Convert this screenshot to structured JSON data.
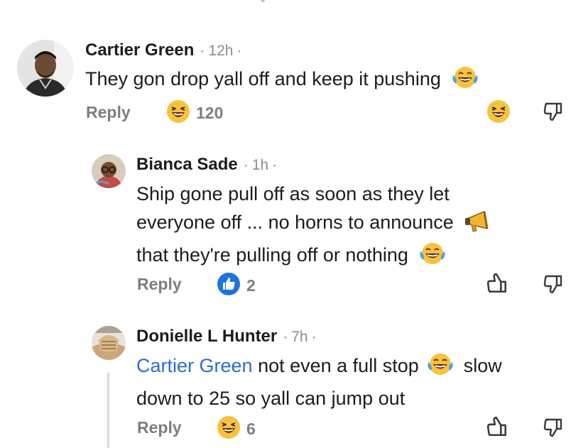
{
  "comments": [
    {
      "author": "Cartier Green",
      "time": "12h",
      "text": "They gon drop yall off and keep it pushing",
      "text_emoji": "laughing-tears-emoji",
      "reply_label": "Reply",
      "reaction_icon": "haha-reaction",
      "reaction_count": "120"
    },
    {
      "author": "Bianca Sade",
      "time": "1h",
      "text_line1": "Ship gone pull off as soon as they let",
      "text_line2": "everyone off ... no horns to announce",
      "text_line2_emoji": "megaphone-emoji",
      "text_line3": "that they're pulling off or nothing",
      "text_line3_emoji": "laughing-tears-emoji",
      "reply_label": "Reply",
      "reaction_icon": "like-reaction",
      "reaction_count": "2"
    },
    {
      "author": "Donielle L Hunter",
      "time": "7h",
      "mention": "Cartier Green",
      "text_part1": "not even a full stop",
      "text_part1_emoji": "laughing-tears-emoji",
      "text_part2": "slow",
      "text_line2": "down to 25 so yall can jump out",
      "reply_label": "Reply",
      "reaction_icon": "haha-reaction",
      "reaction_count": "6"
    }
  ],
  "separator": "·",
  "colors": {
    "text": "#1c1c1e",
    "meta": "#8a8d91",
    "mention": "#2f6bcc",
    "like_blue": "#1b74e4",
    "emoji_yellow": "#f7c23c"
  }
}
